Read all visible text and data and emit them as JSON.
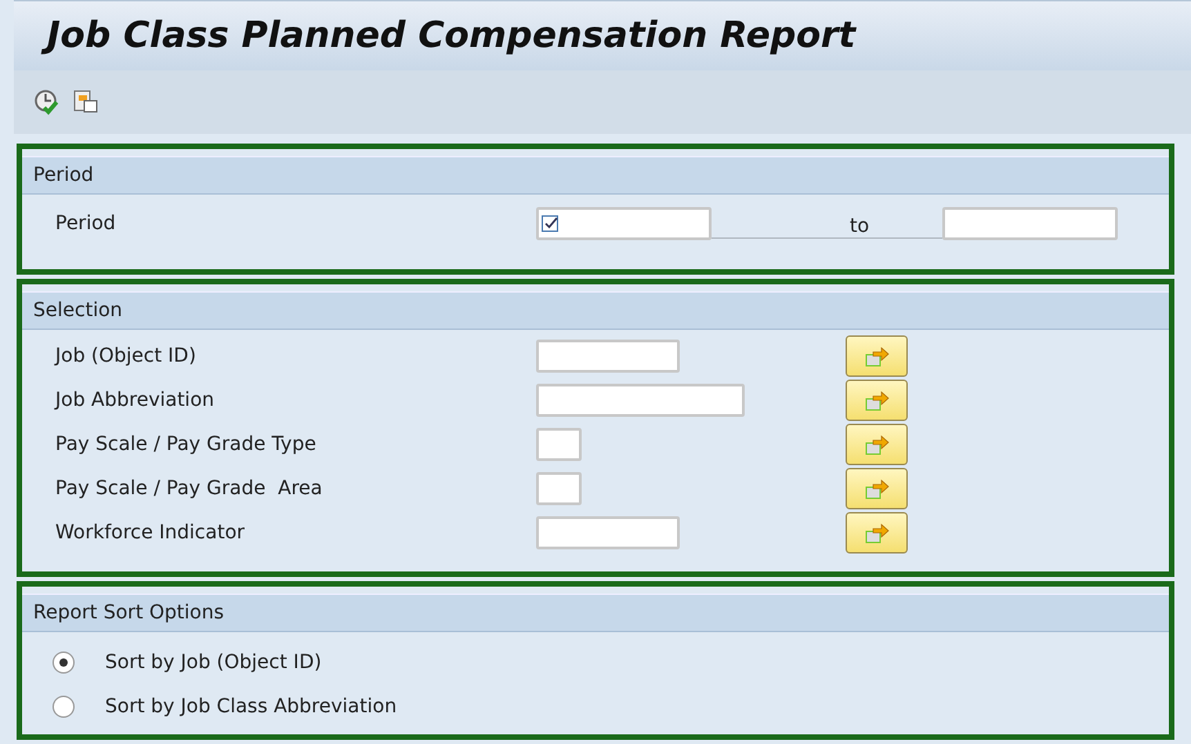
{
  "window": {
    "title": "Job Class Planned Compensation Report"
  },
  "period": {
    "title": "Period",
    "label": "Period",
    "to_label": "to"
  },
  "selection": {
    "title": "Selection",
    "rows": [
      {
        "label": "Job (Object ID)"
      },
      {
        "label": "Job Abbreviation"
      },
      {
        "label": "Pay Scale / Pay Grade Type"
      },
      {
        "label": "Pay Scale / Pay Grade  Area"
      },
      {
        "label": "Workforce Indicator"
      }
    ]
  },
  "sort_options": {
    "title": "Report Sort Options",
    "options": [
      {
        "label": "Sort by Job (Object ID)",
        "selected": true
      },
      {
        "label": "Sort by Job Class Abbreviation",
        "selected": false
      }
    ]
  }
}
